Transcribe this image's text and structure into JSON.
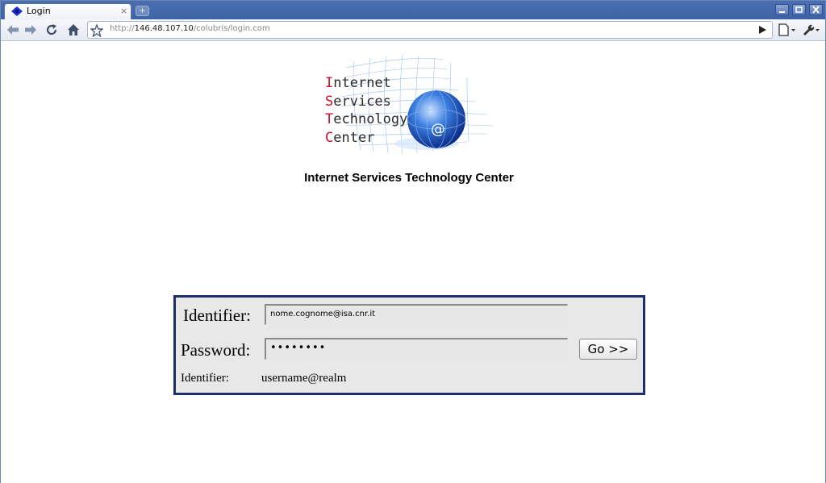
{
  "browser": {
    "tab_title": "Login",
    "tab_close": "×",
    "new_tab": "+",
    "url_prefix": "http://",
    "url_host": "146.48.107.10",
    "url_path": "/colubris/login.com",
    "toolbar_icons": [
      "back-icon",
      "forward-icon",
      "reload-icon",
      "home-icon",
      "star-icon",
      "go-icon",
      "page-menu-icon",
      "wrench-menu-icon"
    ],
    "window_buttons": [
      "minimize",
      "restore",
      "close"
    ]
  },
  "logo": {
    "lines": [
      {
        "cap": "I",
        "rest": "nternet"
      },
      {
        "cap": "S",
        "rest": "ervices"
      },
      {
        "cap": "T",
        "rest": "echnology"
      },
      {
        "cap": "C",
        "rest": "enter"
      }
    ],
    "at_symbol": "@"
  },
  "page": {
    "title": "Internet Services Technology Center"
  },
  "login": {
    "identifier_label": "Identifier:",
    "identifier_value": "nome.cognome@isa.cnr.it",
    "password_label": "Password:",
    "password_value": "••••••••",
    "go_label": "Go >>",
    "hint_label": "Identifier:",
    "hint_value": "username@realm"
  },
  "colors": {
    "accent_red": "#c8102e",
    "box_border": "#1c2f6b",
    "titlebar": "#4a6fb0"
  }
}
